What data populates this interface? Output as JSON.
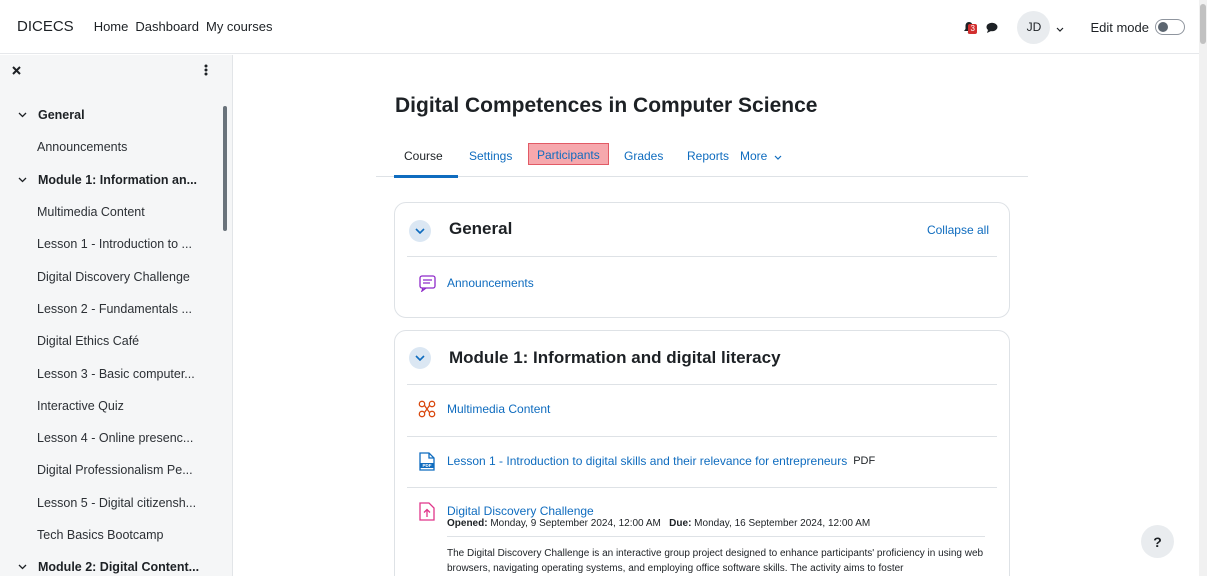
{
  "navbar": {
    "brand": "DICECS",
    "links": [
      "Home",
      "Dashboard",
      "My courses"
    ],
    "notification_count": "3",
    "user_initials": "JD",
    "edit_mode_label": "Edit mode"
  },
  "sidebar": {
    "items": [
      {
        "label": "General",
        "type": "section"
      },
      {
        "label": "Announcements",
        "type": "child"
      },
      {
        "label": "Module 1: Information an...",
        "type": "section"
      },
      {
        "label": "Multimedia Content",
        "type": "child"
      },
      {
        "label": "Lesson 1 - Introduction to ...",
        "type": "child"
      },
      {
        "label": "Digital Discovery Challenge",
        "type": "child"
      },
      {
        "label": "Lesson 2 - Fundamentals ...",
        "type": "child"
      },
      {
        "label": "Digital Ethics Café",
        "type": "child"
      },
      {
        "label": "Lesson 3 - Basic computer...",
        "type": "child"
      },
      {
        "label": "Interactive Quiz",
        "type": "child"
      },
      {
        "label": "Lesson 4 - Online presenc...",
        "type": "child"
      },
      {
        "label": "Digital Professionalism Pe...",
        "type": "child"
      },
      {
        "label": "Lesson 5 - Digital citizensh...",
        "type": "child"
      },
      {
        "label": "Tech Basics Bootcamp",
        "type": "child"
      },
      {
        "label": "Module 2: Digital Content...",
        "type": "section"
      }
    ]
  },
  "page": {
    "title": "Digital Competences in Computer Science",
    "tabs": [
      "Course",
      "Settings",
      "Participants",
      "Grades",
      "Reports",
      "More"
    ]
  },
  "general_section": {
    "title": "General",
    "collapse_all": "Collapse all",
    "activities": [
      {
        "label": "Announcements",
        "icon": "forum-icon"
      }
    ]
  },
  "module1_section": {
    "title": "Module 1: Information and digital literacy",
    "activities": [
      {
        "label": "Multimedia Content",
        "icon": "multimedia-icon"
      },
      {
        "label": "Lesson 1 - Introduction to digital skills and their relevance for entrepreneurs",
        "icon": "pdf-icon",
        "tag": "PDF"
      },
      {
        "label": "Digital Discovery Challenge",
        "icon": "assignment-icon"
      }
    ],
    "challenge": {
      "opened_label": "Opened:",
      "opened_value": " Monday, 9 September 2024, 12:00 AM",
      "due_label": "Due:",
      "due_value": " Monday, 16 September 2024, 12:00 AM",
      "description": "The Digital Discovery Challenge is an interactive group project designed to enhance participants' proficiency in using web browsers, navigating operating systems, and employing office software skills. The activity aims to foster"
    }
  },
  "help_label": "?",
  "colors": {
    "link": "#0f6cbf",
    "highlight_fill": "#f6a8ad",
    "highlight_border": "#e25a65",
    "badge": "#d32f2f"
  }
}
